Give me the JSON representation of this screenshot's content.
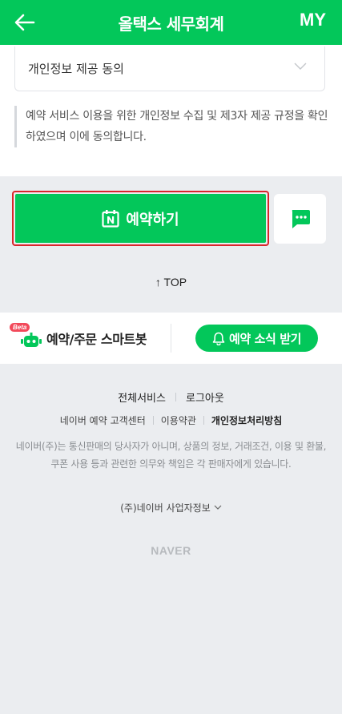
{
  "header": {
    "title": "올택스 세무회계",
    "my_label": "MY",
    "color": "#03c75a",
    "back_icon": "arrow-left-icon"
  },
  "consent": {
    "select_label": "개인정보 제공 동의",
    "notice_text": "예약 서비스 이용을 위한 개인정보 수집 및 제3자 제공 규정을 확인하였으며 이에 동의합니다."
  },
  "actions": {
    "reserve_label": "예약하기",
    "reserve_icon": "naver-calendar-icon",
    "chat_icon": "chat-bubble-icon"
  },
  "top_link": "↑ TOP",
  "promo": {
    "beta_badge": "Beta",
    "smartbot_label": "예약/주문 스마트봇",
    "notify_label": "예약 소식 받기",
    "notify_icon": "bell-icon"
  },
  "footer": {
    "links_row1": [
      "전체서비스",
      "로그아웃"
    ],
    "links_row2": [
      "네이버 예약 고객센터",
      "이용약관",
      "개인정보처리방침"
    ],
    "disclaimer": "네이버(주)는 통신판매의 당사자가 아니며, 상품의 정보, 거래조건, 이용 및 환불, 쿠폰 사용 등과 관련한 의무와 책임은 각 판매자에게 있습니다.",
    "biz_info": "(주)네이버 사업자정보",
    "logo": "NAVER"
  }
}
